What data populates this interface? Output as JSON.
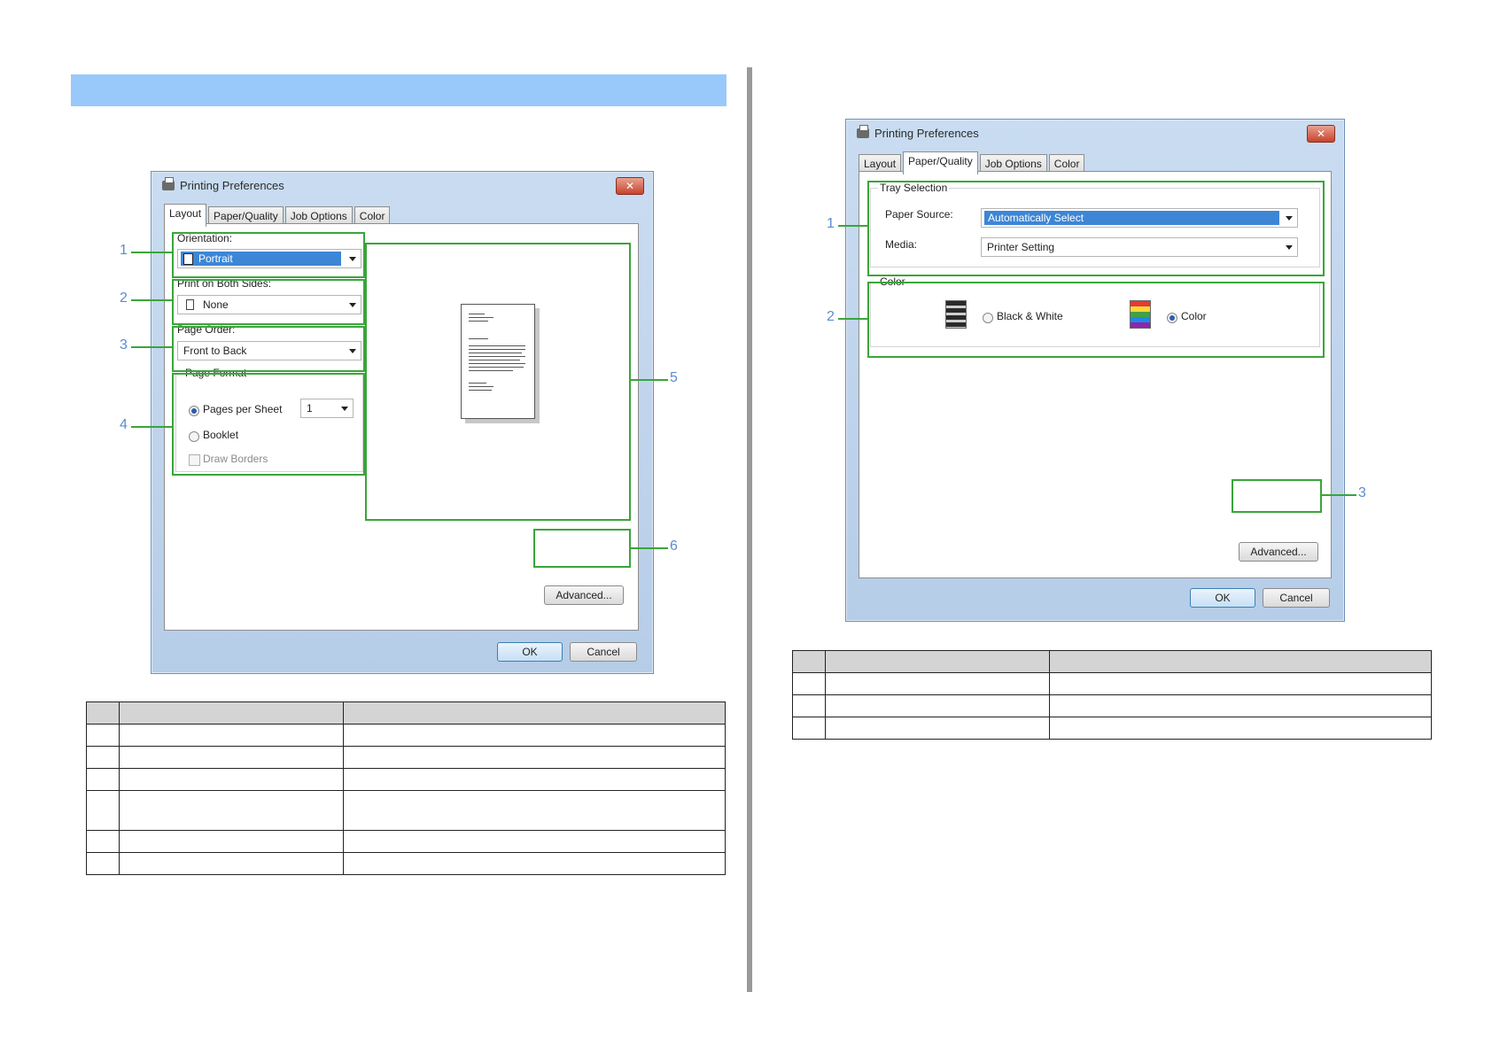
{
  "left_dialog": {
    "title": "Printing Preferences",
    "close": "✕",
    "tabs": [
      "Layout",
      "Paper/Quality",
      "Job Options",
      "Color"
    ],
    "orientation": {
      "label": "Orientation:",
      "value": "Portrait"
    },
    "both_sides": {
      "label": "Print on Both Sides:",
      "value": "None"
    },
    "page_order": {
      "label": "Page Order:",
      "value": "Front to Back"
    },
    "page_format": {
      "title": "Page Format",
      "pages_per_sheet_label": "Pages per Sheet",
      "pages_per_sheet_value": "1",
      "booklet_label": "Booklet",
      "draw_borders_label": "Draw Borders"
    },
    "advanced_label": "Advanced...",
    "ok_label": "OK",
    "cancel_label": "Cancel",
    "callouts": [
      "1",
      "2",
      "3",
      "4",
      "5",
      "6"
    ]
  },
  "right_dialog": {
    "title": "Printing Preferences",
    "close": "✕",
    "tabs": [
      "Layout",
      "Paper/Quality",
      "Job Options",
      "Color"
    ],
    "tray_selection": {
      "title": "Tray Selection",
      "paper_source_label": "Paper Source:",
      "paper_source_value": "Automatically Select",
      "media_label": "Media:",
      "media_value": "Printer Setting"
    },
    "color_group": {
      "title": "Color",
      "bw_label": "Black & White",
      "color_label": "Color",
      "selected": "Color"
    },
    "advanced_label": "Advanced...",
    "ok_label": "OK",
    "cancel_label": "Cancel",
    "callouts": [
      "1",
      "2",
      "3"
    ]
  },
  "colors": {
    "accent_green": "#3aa53a",
    "callout_blue": "#5b8bd2",
    "header_blue": "#99c9fb"
  },
  "left_table_rows": 6,
  "right_table_rows": 3
}
